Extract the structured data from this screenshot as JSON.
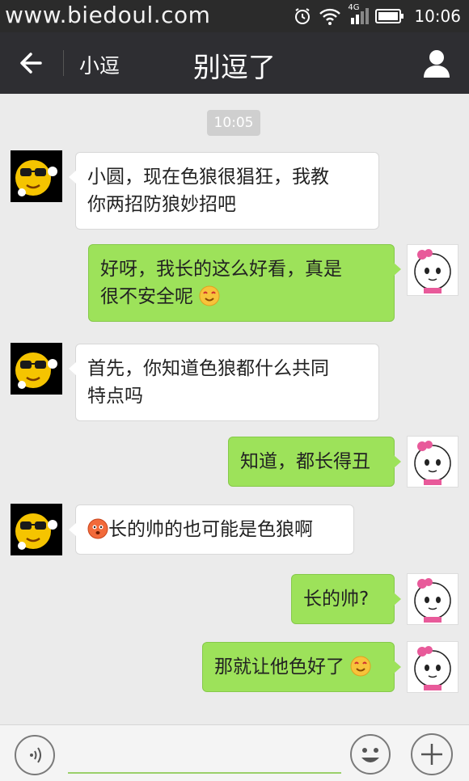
{
  "status_bar": {
    "site": "www.biedoul.com",
    "time": "10:06",
    "network": "4G"
  },
  "header": {
    "back_label": "",
    "contact_name": "小逗",
    "title": "别逗了"
  },
  "chat": {
    "timestamp": "10:05",
    "messages": [
      {
        "side": "left",
        "lines": [
          "小圆，现在色狼很猖狂，我教",
          "你两招防狼妙招吧"
        ]
      },
      {
        "side": "right",
        "lines": [
          "好呀，我长的这么好看，真是",
          "很不安全呢"
        ],
        "emoji": "smiling-heart-eyes-emoji"
      },
      {
        "side": "left",
        "lines": [
          "首先，你知道色狼都什么共同",
          "特点吗"
        ]
      },
      {
        "side": "right",
        "lines": [
          "知道，都长得丑"
        ]
      },
      {
        "side": "left",
        "lines": [
          "长的帅的也可能是色狼啊"
        ],
        "emoji": "blushing-surprised-emoji"
      },
      {
        "side": "right",
        "lines": [
          "长的帅?"
        ]
      },
      {
        "side": "right",
        "lines": [
          "那就让他色好了"
        ],
        "emoji": "smiling-heart-eyes-emoji"
      }
    ]
  },
  "input_bar": {
    "text_value": ""
  },
  "icons": {
    "back": "arrow-left-icon",
    "profile": "person-icon",
    "voice": "voice-icon",
    "sticker": "smiley-icon",
    "plus": "plus-icon",
    "alarm": "alarm-icon",
    "wifi": "wifi-icon",
    "signal": "signal-icon",
    "battery": "battery-icon"
  },
  "colors": {
    "bar": "#2e2e32",
    "sent_bubble": "#9de25a",
    "received_bubble": "#ffffff",
    "background": "#ebebeb"
  }
}
